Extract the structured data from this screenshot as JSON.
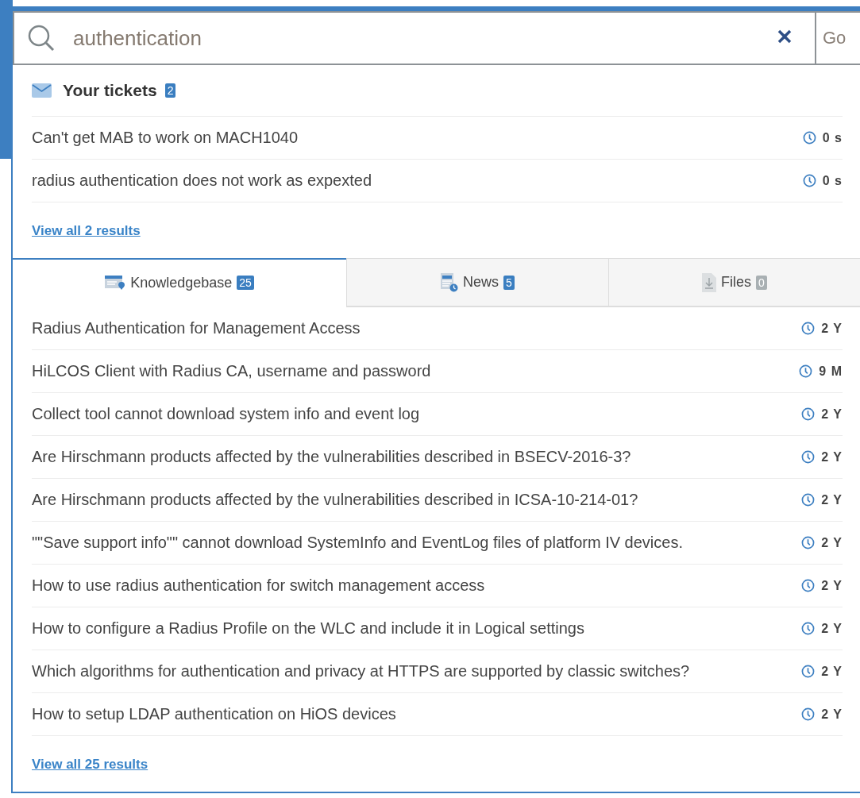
{
  "search": {
    "value": "authentication",
    "go_label": "Go"
  },
  "tickets": {
    "title": "Your tickets",
    "count": "2",
    "items": [
      {
        "title": "Can't get MAB to work on MACH1040",
        "age": "0 s"
      },
      {
        "title": "radius authentication does not work as expexted",
        "age": "0 s"
      }
    ],
    "view_all": "View all 2 results"
  },
  "tabs": [
    {
      "kind": "knowledgebase",
      "label": "Knowledgebase",
      "count": "25",
      "selected": true,
      "disabled": false
    },
    {
      "kind": "news",
      "label": "News",
      "count": "5",
      "selected": false,
      "disabled": false
    },
    {
      "kind": "files",
      "label": "Files",
      "count": "0",
      "selected": false,
      "disabled": true
    }
  ],
  "results": [
    {
      "title": "Radius Authentication for Management Access",
      "age": "2 Y"
    },
    {
      "title": "HiLCOS Client with Radius CA, username and password",
      "age": "9 M"
    },
    {
      "title": "Collect tool cannot download system info and event log",
      "age": "2 Y"
    },
    {
      "title": "Are Hirschmann products affected by the vulnerabilities described in BSECV-2016-3?",
      "age": "2 Y"
    },
    {
      "title": "Are Hirschmann products affected by the vulnerabilities described in ICSA-10-214-01?",
      "age": "2 Y"
    },
    {
      "title": "\"\"Save support info\"\" cannot download SystemInfo and EventLog files of platform IV devices.",
      "age": "2 Y"
    },
    {
      "title": "How to use radius authentication for switch management access",
      "age": "2 Y"
    },
    {
      "title": "How to configure a Radius Profile on the WLC and include it in Logical settings",
      "age": "2 Y"
    },
    {
      "title": "Which algorithms for authentication and privacy at HTTPS are supported by classic switches?",
      "age": "2 Y"
    },
    {
      "title": "How to setup LDAP authentication on HiOS devices",
      "age": "2 Y"
    }
  ],
  "view_all": "View all 25 results"
}
